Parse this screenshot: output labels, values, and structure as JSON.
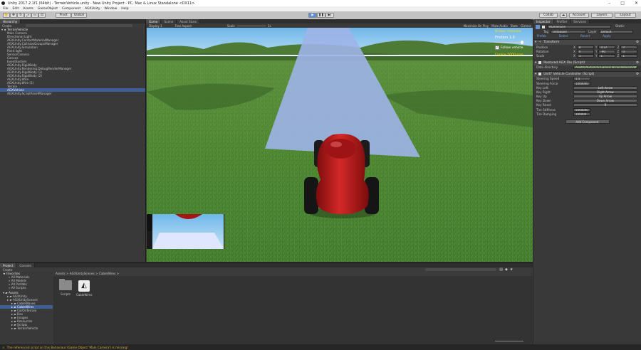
{
  "window": {
    "title": "Unity 2017.2.1f1 (64bit) - TerrainVehicle.unity - New Unity Project - PC, Mac & Linux Standalone <DX11>",
    "controls": [
      "–",
      "□",
      "✕"
    ]
  },
  "menu": [
    "File",
    "Edit",
    "Assets",
    "GameObject",
    "Component",
    "AGXUnity",
    "Window",
    "Help"
  ],
  "toolbar": {
    "pivot": "Pivot",
    "global": "Global",
    "account": "Account",
    "layers": "Layers",
    "layout": "Layout",
    "cloud": "☁",
    "collab": "Collab"
  },
  "hierarchy": {
    "tab": "Hierarchy",
    "create": "Create",
    "scene": "TerrainVehicle",
    "items": [
      "Main Camera",
      "Directional Light",
      "AGXUnity.ContactMaterialManager",
      "AGXUnity.CollisionGroupsManager",
      "AGXUnity.Simulation",
      "Point light",
      "SensorCamera",
      "Canvas",
      "EventSystem",
      "AGXUnity.RigidBody",
      "AGXUnity.Rendering.DebugRenderManager",
      "AGXUnity.RigidBody (1)",
      "AGXUnity.RigidBody (2)",
      "AGXUnity.Wire",
      "AGXUnity.Wire (1)",
      "Terrain",
      "AGXVehicle",
      "AGXUnity.ScriptAssetManager"
    ],
    "selected_index": 16
  },
  "scene_view": {
    "tabs": [
      "Game",
      "Scene",
      "Asset Store"
    ],
    "display": "Display 1",
    "aspect": "Free Aspect",
    "scale_label": "Scale",
    "scale_value": "1x",
    "toggles": [
      "Maximize On Play",
      "Mute Audio",
      "Stats",
      "Gizmos"
    ],
    "overlay": {
      "friction_label": "Friction 1.0",
      "friction_value": 0.95,
      "follow_vehicle": "Follow vehicle",
      "engine": "Engine 5000 rpm",
      "top_yellow": "Brakes released"
    }
  },
  "inspector": {
    "tabs": [
      "Inspector",
      "Profiler",
      "Services"
    ],
    "object_name": "AGXVehicle",
    "static": "Static",
    "tag_label": "Tag",
    "tag_value": "Untagged",
    "layer_label": "Layer",
    "layer_value": "Default",
    "prefab_buttons": [
      "Prefab",
      "Select",
      "Revert",
      "Apply"
    ],
    "transform": {
      "title": "Transform",
      "position": [
        "0",
        "0.37",
        "0"
      ],
      "rotation": [
        "0",
        "-90",
        "0"
      ],
      "scale": [
        "1",
        "1",
        "1"
      ],
      "labels": [
        "Position",
        "Rotation",
        "Scale"
      ],
      "axes": [
        "X",
        "Y",
        "Z"
      ]
    },
    "agx_file": {
      "title": "Restored AGX File (Script)",
      "data_directory_label": "Data directory",
      "data_directory_value": "Assets/AGXUnity/Games/TerrainVehicle/Vehicle"
    },
    "vehicle": {
      "title": "UnitY Vehicle Controller (Script)",
      "rows": [
        {
          "label": "Steering Speed",
          "value": "1.5",
          "type": "field"
        },
        {
          "label": "Steering Force",
          "value": "1000000",
          "type": "field"
        },
        {
          "label": "Key Left",
          "value": "Left Arrow",
          "type": "button"
        },
        {
          "label": "Key Right",
          "value": "Right Arrow",
          "type": "button"
        },
        {
          "label": "Key Up",
          "value": "Up Arrow",
          "type": "button"
        },
        {
          "label": "Key Down",
          "value": "Down Arrow",
          "type": "button"
        },
        {
          "label": "Key Reset",
          "value": "R",
          "type": "button"
        },
        {
          "label": "Tire Stiffness",
          "value": "5000000",
          "type": "field"
        },
        {
          "label": "Tire Damping",
          "value": "100000",
          "type": "field"
        }
      ]
    },
    "add_component": "Add Component"
  },
  "project": {
    "tabs": [
      "Project",
      "Console"
    ],
    "create": "Create",
    "favorites": {
      "title": "Favorites",
      "items": [
        "All Materials",
        "All Models",
        "All Prefabs",
        "All Scripts"
      ]
    },
    "assets": {
      "title": "Assets",
      "items": [
        {
          "label": "AGXUnity",
          "indent": 1
        },
        {
          "label": "AGXUnityScenes",
          "indent": 1
        },
        {
          "label": "CableWaves",
          "indent": 2
        },
        {
          "label": "CableWires",
          "indent": 2
        },
        {
          "label": "CarOnTerrain",
          "indent": 2
        },
        {
          "label": "Dev",
          "indent": 2
        },
        {
          "label": "Images",
          "indent": 2
        },
        {
          "label": "Resources",
          "indent": 2
        },
        {
          "label": "Scripts",
          "indent": 2
        },
        {
          "label": "TerrainVehicle",
          "indent": 2
        }
      ],
      "selected_index": 3
    },
    "breadcrumb": "Assets > AGXUnityScenes > CableWires >",
    "files": [
      {
        "name": "Scripts",
        "icon": "folder-icon"
      },
      {
        "name": "CableWires",
        "icon": "unity-scene-icon"
      }
    ]
  },
  "status": {
    "message": "The referenced script on this Behaviour (Game Object 'Main Camera') is missing!"
  },
  "colors": {
    "overlay_yellow": "#ffe000",
    "selection_blue": "#3e5f96",
    "car_red": "#b81818",
    "sky": "#a4d2f0",
    "grass": "#4e8a34"
  }
}
